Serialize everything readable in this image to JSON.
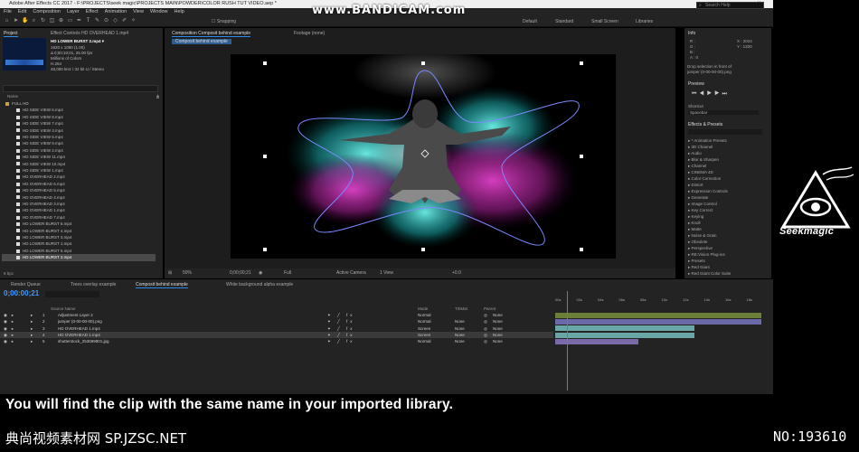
{
  "window": {
    "title": "Adobe After Effects CC 2017 - F:\\PROJECTS\\seek magic\\PROJECTS MAIN\\POWDER\\COLOR RUSH TUT VIDEO.aep *",
    "controls": "– ▫ ✕"
  },
  "overlay": {
    "recorder": "www.BANDICAM.com"
  },
  "menu": [
    "File",
    "Edit",
    "Composition",
    "Layer",
    "Effect",
    "Animation",
    "View",
    "Window",
    "Help"
  ],
  "toolbar": {
    "snapping": "Snapping",
    "workspaces": [
      "Default",
      "Standard",
      "Small Screen",
      "Libraries"
    ],
    "search_placeholder": "Search Help"
  },
  "project": {
    "tab": "Project",
    "effect_controls": "Effect Controls HD OVERHEAD 1.mp4",
    "selected_name": "HD LOWER BURST 2.mp4 ▾",
    "meta": [
      "1920 x 1080 (1.00)",
      "Δ 0;00;10;01, 25.00 fps",
      "Millions of Colors",
      "H.264",
      "48,000 kHz / 32 bit U / Stereo"
    ],
    "name_header": "Name",
    "files": [
      "FULL HD",
      "HD SIDE VIEW 6.mp4",
      "HD SIDE VIEW 8.mp4",
      "HD SIDE VIEW 7.mp4",
      "HD SIDE VIEW 3.mp4",
      "HD SIDE VIEW 5.mp4",
      "HD SIDE VIEW 9.mp4",
      "HD SIDE VIEW 2.mp4",
      "HD SIDE VIEW 11.mp4",
      "HD SIDE VIEW 10.mp4",
      "HD SIDE VIEW 1.mp4",
      "HD OVERHEAD 2.mp4",
      "HD OVERHEAD 6.mp4",
      "HD OVERHEAD 5.mp4",
      "HD OVERHEAD 4.mp4",
      "HD OVERHEAD 3.mp4",
      "HD OVERHEAD 1.mp4",
      "HD OVERHEAD 7.mp4",
      "HD LOWER BURST 6.mp4",
      "HD LOWER BURST 4.mp4",
      "HD LOWER BURST 3.mp4",
      "HD LOWER BURST 1.mp4",
      "HD LOWER BURST 5.mp4",
      "HD LOWER BURST 2.mp4"
    ],
    "footer": "8 bpc"
  },
  "composition": {
    "tab": "Composition Composit behind example",
    "footage_tab": "Footage (none)",
    "sub_tab": "Composit behind example",
    "footer": {
      "zoom": "50%",
      "timecode": "0;00;00;21",
      "res": "Full",
      "camera": "Active Camera",
      "views": "1 View",
      "exposure": "+0.0"
    }
  },
  "right": {
    "info_title": "Info",
    "info_lines": [
      "R :",
      "G :",
      "B :",
      "A : 0"
    ],
    "coords": [
      "X : 2024",
      "Y : 1320"
    ],
    "drop_hint": [
      "Drop selection in front of:",
      "jumper (0-00-00-00).png"
    ],
    "preview_title": "Preview",
    "shortcut_label": "Shortcut",
    "shortcut_value": "Spacebar",
    "effects_title": "Effects & Presets",
    "effects": [
      "* Animation Presets",
      "3D Channel",
      "Audio",
      "Blur & Sharpen",
      "Channel",
      "CINEMA 4D",
      "Color Correction",
      "Distort",
      "Expression Controls",
      "Generate",
      "Image Control",
      "Key Correct",
      "Keying",
      "Knoll",
      "Matte",
      "Noise & Grain",
      "Obsolete",
      "Perspective",
      "RE:Vision Plug-ins",
      "Presets",
      "Red Giant",
      "Red Giant Color Suite"
    ]
  },
  "timeline": {
    "tabs": [
      "Render Queue",
      "Trees overlay example",
      "Composit behind example",
      "White background alpha example"
    ],
    "timecode": "0;00:00;21",
    "header": {
      "source": "Source Name",
      "mode": "Mode",
      "trkmat": "TrkMat",
      "parent": "Parent"
    },
    "ruler": [
      "00s",
      "02s",
      "04s",
      "06s",
      "08s",
      "10s",
      "12s",
      "14s",
      "16s",
      "18s"
    ],
    "layers": [
      {
        "num": "1",
        "name": "Adjustment Layer 2",
        "mode": "Normal",
        "trk": "",
        "parent": "None"
      },
      {
        "num": "2",
        "name": "jumper (0-00-00-00).png",
        "mode": "Normal",
        "trk": "None",
        "parent": "None"
      },
      {
        "num": "3",
        "name": "HD OVERHEAD 1.mp4",
        "mode": "Screen",
        "trk": "None",
        "parent": "None"
      },
      {
        "num": "4",
        "name": "HD OVERHEAD 1.mp4",
        "mode": "Screen",
        "trk": "None",
        "parent": "None"
      },
      {
        "num": "5",
        "name": "shutterstock_253699801.jpg",
        "mode": "Normal",
        "trk": "None",
        "parent": "None"
      }
    ]
  },
  "caption": "You will find the clip with the same name in your imported library.",
  "watermark": {
    "left": "典尚视频素材网 SP.JZSC.NET",
    "right": "NO:193610",
    "brand": "Seekmagic"
  }
}
